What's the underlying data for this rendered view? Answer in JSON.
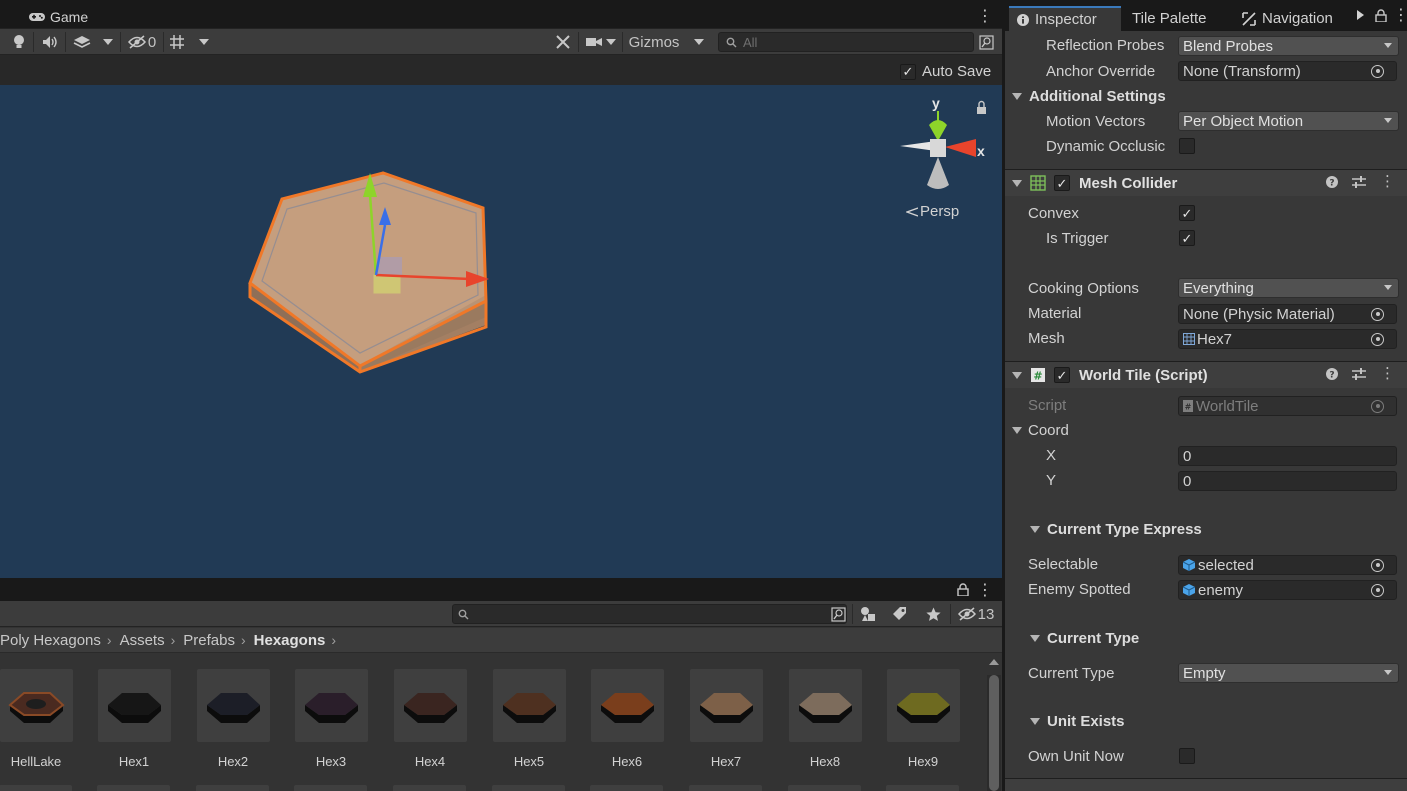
{
  "scene": {
    "tab_title": "Game",
    "toolbar": {
      "hidden_count": "0",
      "gizmos_label": "Gizmos",
      "search_placeholder": "All"
    },
    "auto_save_label": "Auto Save",
    "auto_save_checked": true,
    "gizmo": {
      "y_label": "y",
      "x_label": "x",
      "persp_label": "Persp"
    }
  },
  "project": {
    "hidden_count": "13",
    "breadcrumb": [
      "Poly Hexagons",
      "Assets",
      "Prefabs",
      "Hexagons"
    ],
    "assets": [
      {
        "name": "HellLake",
        "color": "#4a2a20"
      },
      {
        "name": "Hex1",
        "color": "#161616"
      },
      {
        "name": "Hex2",
        "color": "#1c1e27"
      },
      {
        "name": "Hex3",
        "color": "#2a1e2a"
      },
      {
        "name": "Hex4",
        "color": "#3a2520"
      },
      {
        "name": "Hex5",
        "color": "#4e3020"
      },
      {
        "name": "Hex6",
        "color": "#7a3e1c"
      },
      {
        "name": "Hex7",
        "color": "#7d6048"
      },
      {
        "name": "Hex8",
        "color": "#7d6c5c"
      },
      {
        "name": "Hex9",
        "color": "#6e6a20"
      }
    ]
  },
  "inspector": {
    "tabs": {
      "inspector": "Inspector",
      "tile_palette": "Tile Palette",
      "navigation": "Navigation"
    },
    "reflection_probes": {
      "label": "Reflection Probes",
      "value": "Blend Probes"
    },
    "anchor_override": {
      "label": "Anchor Override",
      "value": "None (Transform)"
    },
    "additional_settings": "Additional Settings",
    "motion_vectors": {
      "label": "Motion Vectors",
      "value": "Per Object Motion"
    },
    "dynamic_occlusion": {
      "label": "Dynamic Occlusic",
      "checked": false
    },
    "mesh_collider": {
      "title": "Mesh Collider",
      "convex": {
        "label": "Convex",
        "checked": true
      },
      "is_trigger": {
        "label": "Is Trigger",
        "checked": true
      },
      "cooking_options": {
        "label": "Cooking Options",
        "value": "Everything"
      },
      "material": {
        "label": "Material",
        "value": "None (Physic Material)"
      },
      "mesh": {
        "label": "Mesh",
        "value": "Hex7"
      }
    },
    "world_tile": {
      "title": "World Tile (Script)",
      "script": {
        "label": "Script",
        "value": "WorldTile"
      },
      "coord_label": "Coord",
      "x": {
        "label": "X",
        "value": "0"
      },
      "y": {
        "label": "Y",
        "value": "0"
      },
      "current_type_express": "Current Type Express",
      "selectable": {
        "label": "Selectable",
        "value": "selected"
      },
      "enemy_spotted": {
        "label": "Enemy Spotted",
        "value": "enemy"
      },
      "current_type_header": "Current Type",
      "current_type": {
        "label": "Current Type",
        "value": "Empty"
      },
      "unit_exists": "Unit Exists",
      "own_unit_now": {
        "label": "Own Unit Now",
        "checked": false
      }
    }
  },
  "colors": {
    "viewport_bg": "#213a55",
    "accent": "#3a79bb",
    "selection_outline": "#f07828",
    "x_axis": "#e8442c",
    "y_axis": "#8ed42a",
    "z_axis": "#3a6fe8"
  }
}
